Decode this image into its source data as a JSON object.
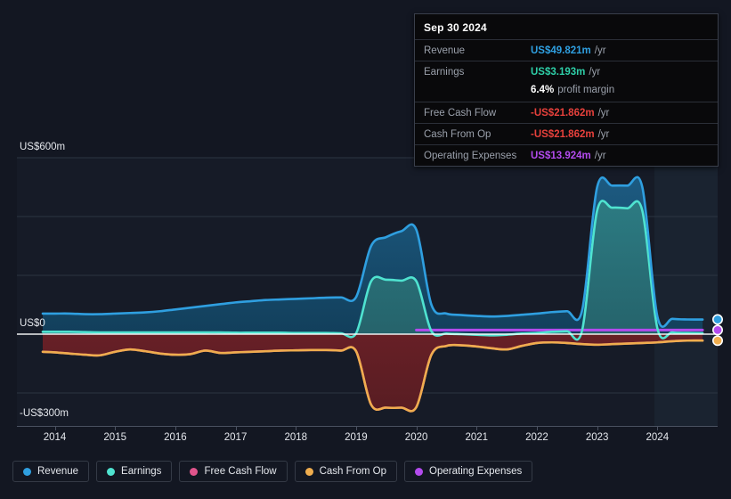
{
  "tooltip": {
    "date": "Sep 30 2024",
    "rows": [
      {
        "label": "Revenue",
        "value": "US$49.821m",
        "unit": "/yr",
        "color": "#2f9fe0"
      },
      {
        "label": "Earnings",
        "value": "US$3.193m",
        "unit": "/yr",
        "color": "#2ecfa8"
      },
      {
        "label": "Free Cash Flow",
        "value": "-US$21.862m",
        "unit": "/yr",
        "color": "#e8413c"
      },
      {
        "label": "Cash From Op",
        "value": "-US$21.862m",
        "unit": "/yr",
        "color": "#e8413c"
      },
      {
        "label": "Operating Expenses",
        "value": "US$13.924m",
        "unit": "/yr",
        "color": "#b34bee"
      }
    ],
    "sub": {
      "value": "6.4%",
      "text": "profit margin"
    }
  },
  "legend": [
    {
      "label": "Revenue",
      "color": "#2f9fe0"
    },
    {
      "label": "Earnings",
      "color": "#4fe3d0"
    },
    {
      "label": "Free Cash Flow",
      "color": "#e0548c"
    },
    {
      "label": "Cash From Op",
      "color": "#efad4e"
    },
    {
      "label": "Operating Expenses",
      "color": "#b34bee"
    }
  ],
  "axis": {
    "y_labels": [
      {
        "text": "US$600m",
        "y": 159
      },
      {
        "text": "US$0",
        "y": 357
      },
      {
        "text": "-US$300m",
        "y": 458
      }
    ],
    "x_labels": [
      "2014",
      "2015",
      "2016",
      "2017",
      "2018",
      "2019",
      "2020",
      "2021",
      "2022",
      "2023",
      "2024"
    ]
  },
  "chart_data": {
    "type": "area",
    "title": "",
    "xlabel": "",
    "ylabel": "US$",
    "ylim": [
      -300,
      600
    ],
    "xlim": [
      2013.8,
      2025.0
    ],
    "grid": true,
    "legend_position": "bottom",
    "gridlines": [
      600,
      400,
      200,
      0,
      -200
    ],
    "x": [
      2013.8,
      2014.0,
      2014.25,
      2014.5,
      2014.75,
      2015.0,
      2015.25,
      2015.5,
      2015.75,
      2016.0,
      2016.25,
      2016.5,
      2016.75,
      2017.0,
      2017.25,
      2017.5,
      2017.75,
      2018.0,
      2018.25,
      2018.5,
      2018.75,
      2019.0,
      2019.25,
      2019.5,
      2019.75,
      2020.0,
      2020.25,
      2020.5,
      2020.75,
      2021.0,
      2021.25,
      2021.5,
      2021.75,
      2022.0,
      2022.25,
      2022.5,
      2022.75,
      2023.0,
      2023.25,
      2023.5,
      2023.75,
      2024.0,
      2024.25,
      2024.5,
      2024.75
    ],
    "series": [
      {
        "name": "Revenue",
        "color": "#2f9fe0",
        "values": [
          70,
          70,
          70,
          68,
          68,
          70,
          72,
          74,
          78,
          84,
          90,
          96,
          102,
          108,
          112,
          116,
          118,
          120,
          122,
          124,
          125,
          126,
          300,
          330,
          350,
          355,
          100,
          70,
          65,
          62,
          60,
          62,
          66,
          70,
          75,
          78,
          80,
          500,
          505,
          505,
          500,
          60,
          52,
          50,
          49.8
        ]
      },
      {
        "name": "Earnings",
        "color": "#4fe3d0",
        "values": [
          8,
          8,
          8,
          7,
          6,
          6,
          6,
          6,
          6,
          6,
          6,
          6,
          6,
          5,
          5,
          5,
          5,
          4,
          4,
          4,
          3,
          3,
          180,
          185,
          182,
          180,
          10,
          2,
          0,
          -2,
          -4,
          -2,
          2,
          4,
          8,
          10,
          12,
          420,
          430,
          428,
          420,
          20,
          6,
          4,
          3.2
        ]
      },
      {
        "name": "Free Cash Flow",
        "color": "#e0548c",
        "values": [
          -60,
          -62,
          -66,
          -70,
          -72,
          -60,
          -52,
          -58,
          -66,
          -70,
          -68,
          -56,
          -64,
          -62,
          -60,
          -58,
          -56,
          -55,
          -54,
          -54,
          -56,
          -58,
          -240,
          -250,
          -250,
          -248,
          -70,
          -40,
          -38,
          -42,
          -48,
          -52,
          -40,
          -30,
          -28,
          -30,
          -34,
          -36,
          -34,
          -32,
          -30,
          -28,
          -24,
          -22,
          -21.9
        ]
      },
      {
        "name": "Cash From Op",
        "color": "#efad4e",
        "values": [
          -60,
          -62,
          -66,
          -70,
          -72,
          -60,
          -52,
          -58,
          -66,
          -70,
          -68,
          -56,
          -64,
          -62,
          -60,
          -58,
          -56,
          -55,
          -54,
          -54,
          -56,
          -58,
          -240,
          -250,
          -250,
          -248,
          -70,
          -40,
          -38,
          -42,
          -48,
          -52,
          -40,
          -30,
          -28,
          -30,
          -34,
          -36,
          -34,
          -32,
          -30,
          -28,
          -24,
          -22,
          -21.9
        ]
      },
      {
        "name": "Operating Expenses",
        "color": "#b34bee",
        "values": [
          null,
          null,
          null,
          null,
          null,
          null,
          null,
          null,
          null,
          null,
          null,
          null,
          null,
          null,
          null,
          null,
          null,
          null,
          null,
          null,
          null,
          null,
          null,
          null,
          null,
          14,
          14,
          14,
          14,
          14,
          14,
          14,
          14,
          14,
          14,
          14,
          14,
          14,
          14,
          14,
          14,
          14,
          14,
          14,
          13.9
        ]
      }
    ],
    "endpoints": [
      {
        "name": "Revenue",
        "value": 49.821,
        "color": "#2f9fe0"
      },
      {
        "name": "Operating Expenses",
        "value": 13.924,
        "color": "#b34bee"
      },
      {
        "name": "Cash From Op",
        "value": -21.862,
        "color": "#efad4e"
      }
    ]
  }
}
